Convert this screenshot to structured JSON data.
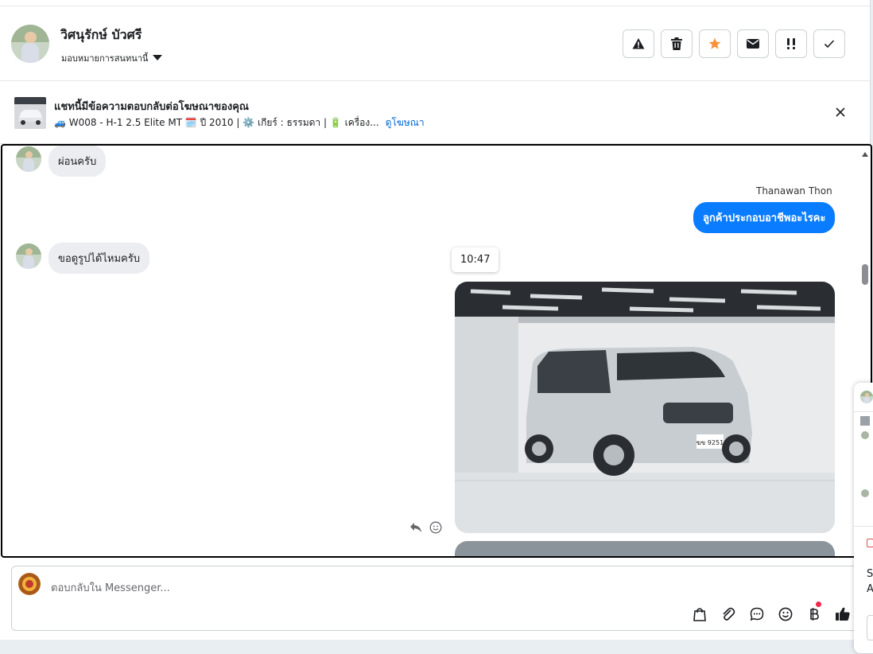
{
  "header": {
    "name": "วิศนุรักษ์ บัวศรี",
    "assign_label": "มอบหมายการสนทนานี้"
  },
  "ad": {
    "title": "แชทนี้มีข้อความตอบกลับต่อโฆษณาของคุณ",
    "subtitle": "🚙 W008 - H-1 2.5 Elite MT 🗓️ ปี 2010 | ⚙️ เกียร์ : ธรรมดา | 🔋 เครื่อง...",
    "link": "ดูโฆษณา"
  },
  "messages": [
    {
      "from": "customer",
      "text": "ผ่อนครับ"
    },
    {
      "from": "page",
      "sender": "Thanawan Thon",
      "text": "ลูกค้าประกอบอาชีพอะไรคะ"
    },
    {
      "from": "customer",
      "text": "ขอดูรูปได้ไหมครับ"
    }
  ],
  "tooltip_time": "10:47",
  "photo": {
    "plate": "ฆข 9251"
  },
  "composer": {
    "placeholder": "ตอบกลับใน Messenger..."
  },
  "side_panel": {
    "text_1": "S",
    "text_2": "A"
  },
  "colors": {
    "accent": "#0a7cff",
    "star": "#f7923b",
    "link": "#0064d1",
    "badge": "#f02849"
  }
}
